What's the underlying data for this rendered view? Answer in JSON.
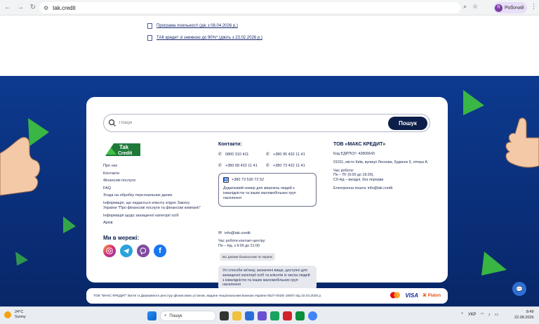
{
  "browser": {
    "url": "tak.credit",
    "profile_label": "Робочий",
    "profile_initial": "R"
  },
  "top_links": [
    "Програма лояльності (діє з 08.04.2026 р.)",
    "ТАК кредит зі знижкою до 90%* (діють з 23.02.2026 р.)"
  ],
  "search": {
    "placeholder": "Пошук",
    "button_label": "Пошук"
  },
  "logo": {
    "line1": "Tak",
    "line2": "Credit"
  },
  "nav": [
    "Про нас",
    "Контакти",
    "Фінансові послуги",
    "FAQ",
    "Згода на обробку персональних даних",
    "Інформація, що надається клієнту згідно Закону України \"Про фінансові послуги та фінансові компанії\"",
    "Інформація щодо захищеної категорії осіб",
    "Архів"
  ],
  "social": {
    "title": "Ми в мережі:",
    "icons": [
      "instagram-icon",
      "telegram-icon",
      "viber-icon",
      "facebook-icon"
    ]
  },
  "contacts": {
    "title": "Контакти:",
    "phones": [
      "0800 310 411",
      "+380 95 432 11 41",
      "+380 68 432 11 41",
      "+380 73 432 11 41"
    ],
    "special_phone": "+380 73 530 72 52",
    "special_desc": "Додатковий номер для звернень людей з інвалідністю та інших маломобільних груп населення",
    "email": "info@tak.credit",
    "hours_title": "Час роботи контакт-центру:",
    "hours": "Пн – Нд. з 9:00 до 21:00",
    "free_badge": "Всі дзвінки безкоштовні по Україні",
    "note": "Усі способи зв'язку, зазначені вище, доступні для захищеної категорії осіб та клієнтів із числа людей з інвалідністю та інших маломобільних груп населення"
  },
  "company": {
    "title": "ТОВ «МАКС КРЕДИТ»",
    "edrpou": "Код ЄДРПОУ: 42806643",
    "address": "01011, місто Київ, вулиця Лескова, будинок 9, літера А.",
    "hours_title": "Час роботи:",
    "hours_line1": "Пн – Пт (9.00 до 18.00),",
    "hours_line2": "Сб-Нд – вихідні, без перерви",
    "email_line": "Електронна пошта: info@tak.credit"
  },
  "legal_text": "ТОВ \"МАКС КРЕДИТ\" Витяг із Державного реєстру фінансових установ, виданe Національним Банком України №27-0026/ 18007 від 10.03.2025 р.",
  "payments": {
    "visa": "VISA",
    "platon": "Platon"
  },
  "taskbar": {
    "weather_temp": "24°C",
    "weather_desc": "Sunny",
    "search_placeholder": "Пошук",
    "lang": "УКР",
    "time": "8:49",
    "date": "22.08.2026"
  },
  "colors": {
    "footer_bg": "#0a2e78",
    "accent_navy": "#0c1f4a",
    "accent_green": "#3ec43e"
  }
}
